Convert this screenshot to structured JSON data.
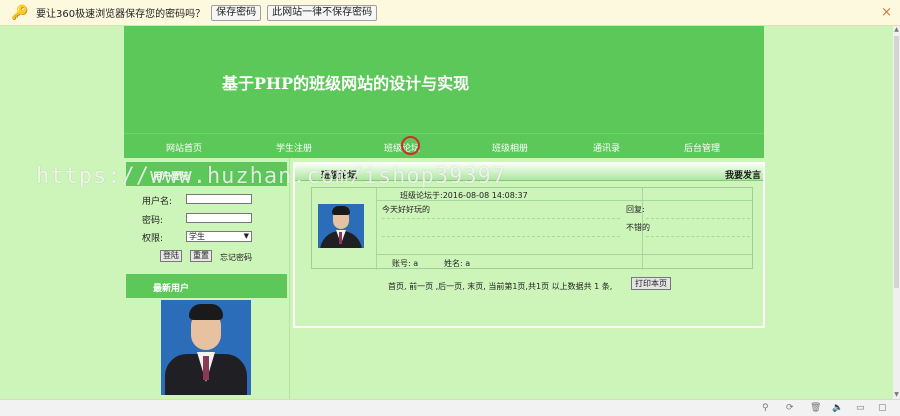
{
  "password_bar": {
    "message": "要让360极速浏览器保存您的密码吗？",
    "save_button": "保存密码",
    "never_button": "此网站一律不保存密码",
    "close": "×"
  },
  "site": {
    "title": "基于PHP的班级网站的设计与实现",
    "nav": [
      "网站首页",
      "学生注册",
      "班级论坛",
      "班级相册",
      "通讯录",
      "后台管理"
    ]
  },
  "sidebar": {
    "login_header": "用户登陆",
    "username_label": "用户名:",
    "password_label": "密码:",
    "role_label": "权限:",
    "role_value": "学生",
    "login_button": "登陆",
    "reset_button": "重置",
    "forgot_link": "忘记密码",
    "new_users_header": "最新用户"
  },
  "forum": {
    "header": "班级论坛",
    "post_button": "我要发言",
    "post": {
      "posted_at": "班级论坛于:2016-08-08 14:08:37",
      "content": "今天好好玩的",
      "reply_label": "回复:",
      "reply_content": "不错的",
      "account": "账号: a",
      "name": "姓名: a"
    },
    "pager": "首页, 前一页 ,后一页, 末页, 当前第1页,共1页 以上数据共 1 条,",
    "print_button": "打印本页"
  },
  "watermark": "https://www.huzhan.com/ishop39397"
}
